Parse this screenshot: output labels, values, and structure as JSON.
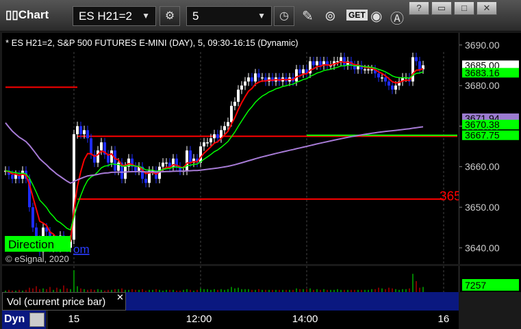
{
  "window": {
    "title": "Chart"
  },
  "toolbar": {
    "symbol": "ES H21=2",
    "interval": "5",
    "icons": [
      "settings-icon",
      "clock-icon",
      "pencil-icon",
      "indicator-icon",
      "get-icon",
      "play-icon",
      "text-icon"
    ],
    "help_label": "?",
    "window_buttons": [
      "?",
      "▭",
      "□",
      "✕"
    ]
  },
  "chart_header": "* ES H21=2, S&P 500 FUTURES E-MINI (DAY), 5, 09:30-16:15 (Dynamic)",
  "copyright": "© eSignal, 2020",
  "direction_label": "Direction",
  "direction_suffix": "om",
  "level_label": "365",
  "volume_caption": "Vol (current price bar)",
  "volume_value": "7257",
  "dyn_label": "Dyn",
  "colors": {
    "up_candle": "#ffffff",
    "down_candle": "#1e2cff",
    "red_line": "#ff0000",
    "green_line": "#00ff00",
    "purple_line": "#a77bd6",
    "badge_green": "#00ff00",
    "badge_purple": "#9b7bd0",
    "badge_white": "#ffffff"
  },
  "chart_data": {
    "type": "candlestick",
    "ylim": [
      3636,
      3693
    ],
    "y_ticks": [
      "3690.00",
      "3680.00",
      "3670.00",
      "3660.00",
      "3650.00",
      "3640.00"
    ],
    "y_tick_values": [
      3690,
      3680,
      3670,
      3660,
      3650,
      3640
    ],
    "x_ticks": [
      "15",
      "12:00",
      "14:00",
      "16"
    ],
    "x_tick_index": [
      20,
      57,
      88,
      128
    ],
    "price_badges": [
      {
        "label": "3685.00",
        "value": 3685.0,
        "color": "white"
      },
      {
        "label": "3683.16",
        "value": 3683.16,
        "color": "green"
      },
      {
        "label": "3671.94",
        "value": 3671.94,
        "color": "purple"
      },
      {
        "label": "3670.38",
        "value": 3670.38,
        "color": "green"
      },
      {
        "label": "3667.75",
        "value": 3667.75,
        "color": "green"
      }
    ],
    "horizontal_levels": [
      {
        "value": 3679.6,
        "from": 0,
        "to": 21,
        "color": "red"
      },
      {
        "value": 3667.5,
        "from": 21,
        "to": 132,
        "color": "red"
      },
      {
        "value": 3652.0,
        "from": 21,
        "to": 128,
        "color": "red"
      },
      {
        "value": 3667.75,
        "from": 88,
        "to": 132,
        "color": "green"
      }
    ],
    "closes": [
      3659,
      3658,
      3657,
      3658,
      3657,
      3659,
      3657,
      3650,
      3645,
      3642,
      3639,
      3645,
      3644,
      3640,
      3642,
      3640,
      3643,
      3641,
      3640,
      3642,
      3668,
      3670,
      3668,
      3669,
      3667,
      3663,
      3661,
      3664,
      3666,
      3663,
      3661,
      3664,
      3659,
      3661,
      3657,
      3660,
      3662,
      3660,
      3659,
      3660,
      3657,
      3656,
      3659,
      3659,
      3657,
      3660,
      3661,
      3661,
      3660,
      3662,
      3660,
      3659,
      3659,
      3664,
      3661,
      3662,
      3661,
      3665,
      3666,
      3666,
      3667,
      3668,
      3667,
      3669,
      3670,
      3671,
      3675,
      3676,
      3679,
      3680,
      3681,
      3682,
      3681,
      3683,
      3682,
      3682,
      3681,
      3682,
      3681,
      3682,
      3681,
      3682,
      3681,
      3682,
      3681,
      3684,
      3683,
      3684,
      3683,
      3686,
      3685,
      3686,
      3685,
      3686,
      3685,
      3685,
      3686,
      3686,
      3687,
      3685,
      3686,
      3685,
      3684,
      3685,
      3684,
      3684,
      3684,
      3684,
      3683,
      3682,
      3682,
      3681,
      3680,
      3679,
      3680,
      3681,
      3682,
      3682,
      3681,
      3687,
      3686,
      3684,
      3685
    ],
    "volumes": [
      2,
      3,
      2,
      2,
      3,
      2,
      3,
      6,
      5,
      8,
      4,
      5,
      4,
      7,
      3,
      6,
      4,
      9,
      5,
      4,
      30,
      8,
      5,
      4,
      3,
      4,
      3,
      4,
      3,
      2,
      3,
      3,
      4,
      4,
      5,
      3,
      3,
      4,
      3,
      3,
      4,
      2,
      3,
      3,
      4,
      3,
      2,
      3,
      3,
      3,
      2,
      2,
      3,
      4,
      3,
      2,
      3,
      5,
      4,
      4,
      3,
      4,
      3,
      4,
      3,
      4,
      7,
      5,
      6,
      4,
      4,
      4,
      3,
      3,
      4,
      3,
      3,
      3,
      3,
      3,
      3,
      3,
      3,
      3,
      3,
      5,
      4,
      4,
      4,
      5,
      3,
      4,
      3,
      4,
      3,
      3,
      3,
      4,
      3,
      3,
      3,
      3,
      3,
      3,
      3,
      3,
      3,
      4,
      4,
      6,
      5,
      4,
      6,
      5,
      4,
      3,
      4,
      4,
      5,
      25,
      15,
      6,
      7
    ]
  }
}
